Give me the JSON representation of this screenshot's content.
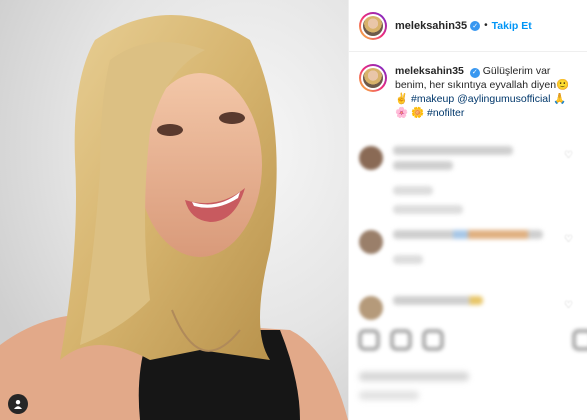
{
  "header": {
    "username": "meleksahin35",
    "verified_icon": "verified-badge-icon",
    "separator": "•",
    "follow_label": "Takip Et"
  },
  "caption": {
    "username": "meleksahin35",
    "text_part1": "Gülüşlerim var benim, her sıkıntıya eyvallah diyen",
    "emoji_smile": "🙂",
    "emoji_hand": "✌",
    "link_makeup": "#makeup",
    "link_mention": "@aylingumusofficial",
    "emoji_pray": "🙏",
    "emoji_flower1": "🌸",
    "emoji_flower2": "🌼",
    "link_nofilter": "#nofilter"
  },
  "colors": {
    "link": "#00376b",
    "follow": "#0095f6",
    "verified": "#3897f0"
  }
}
